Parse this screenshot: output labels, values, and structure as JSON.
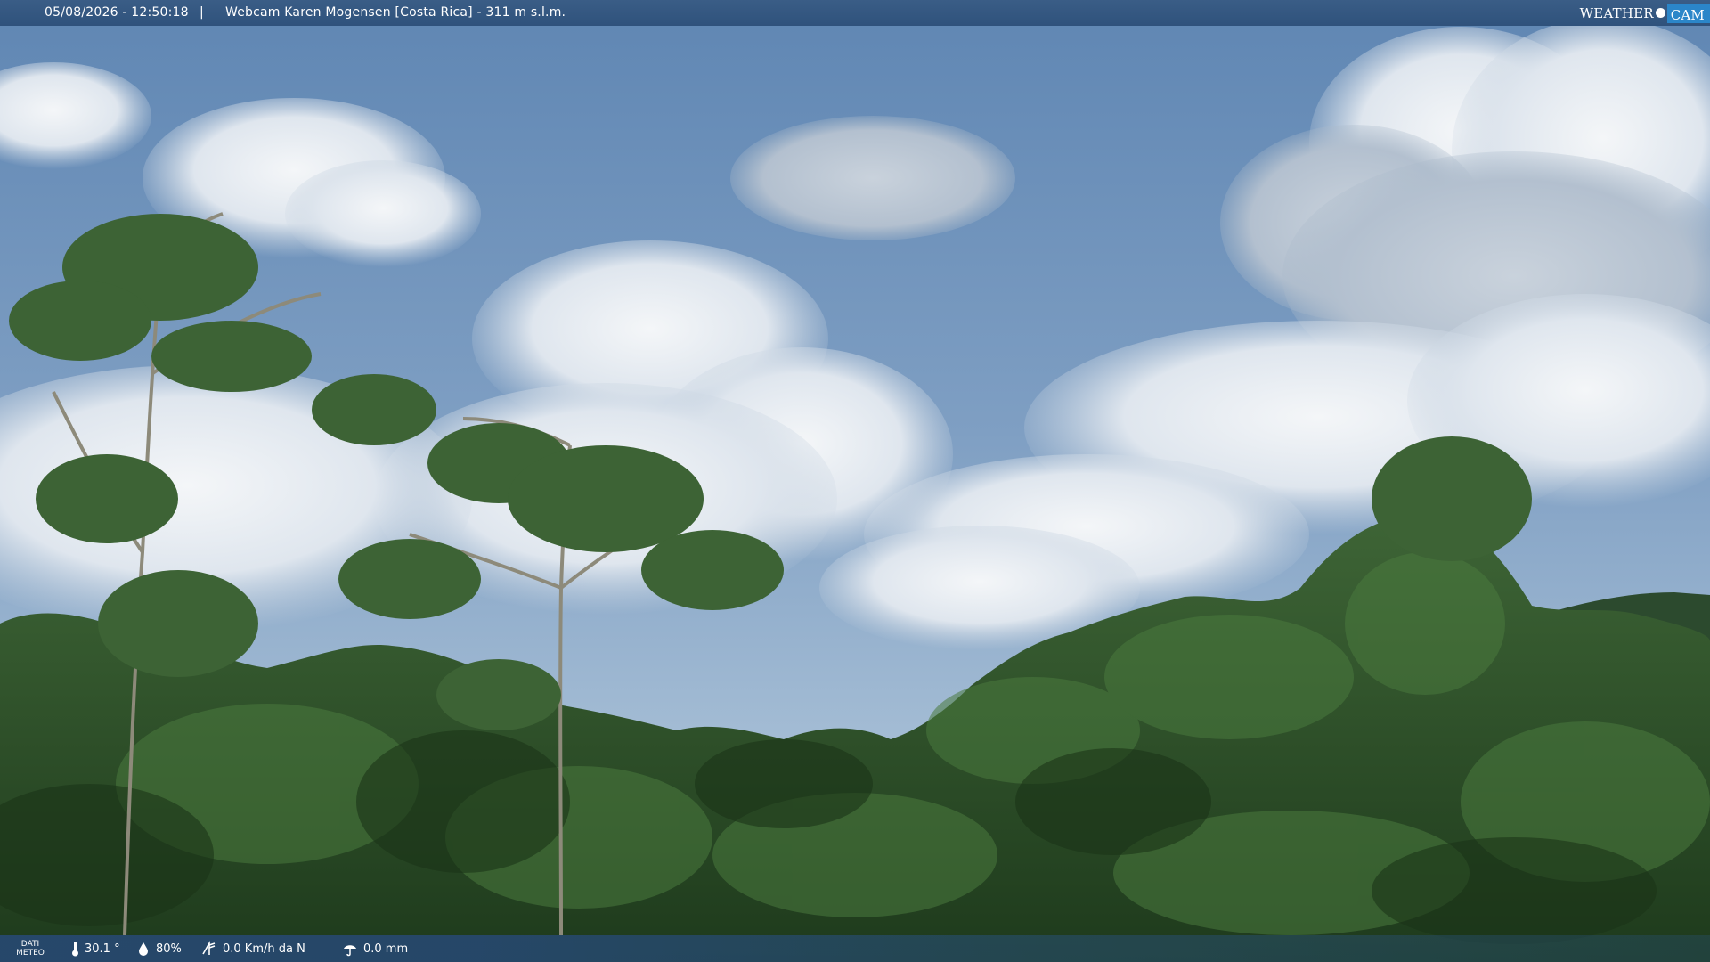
{
  "header": {
    "datetime": "05/08/2026 - 12:50:18",
    "separator": "|",
    "title": "Webcam Karen Mogensen [Costa Rica] - 311 m s.l.m."
  },
  "logo": {
    "weather": "WEATHER",
    "cam": "CAM"
  },
  "weather_bar": {
    "label_line1": "DATI",
    "label_line2": "METEO",
    "temperature": "30.1 °",
    "humidity": "80%",
    "wind": "0.0 Km/h da N",
    "rain": "0.0 mm"
  },
  "colors": {
    "bar": "#2f527c",
    "logo_cam": "#2b86c9",
    "sky": "#6f93b9",
    "foliage": "#2f4f2a"
  }
}
